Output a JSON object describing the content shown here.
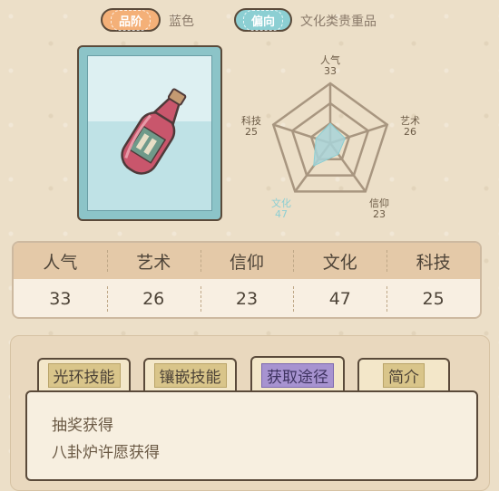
{
  "header": {
    "rank_label": "品阶",
    "rank_value": "蓝色",
    "bias_label": "偏向",
    "bias_value": "文化类贵重品"
  },
  "item": {
    "icon": "pink-bottle-icon"
  },
  "radar": {
    "labels": {
      "popularity": "人气",
      "art": "艺术",
      "faith": "信仰",
      "culture": "文化",
      "tech": "科技"
    },
    "values": {
      "popularity": "33",
      "art": "26",
      "faith": "23",
      "culture": "47",
      "tech": "25"
    },
    "max_value": 100,
    "highlight": "culture",
    "highlight_color": "#8ccfd3"
  },
  "stats_table": {
    "headers": [
      "人气",
      "艺术",
      "信仰",
      "文化",
      "科技"
    ],
    "values": [
      "33",
      "26",
      "23",
      "47",
      "25"
    ]
  },
  "tabs": [
    {
      "label": "光环技能",
      "active": false
    },
    {
      "label": "镶嵌技能",
      "active": false
    },
    {
      "label": "获取途径",
      "active": true
    },
    {
      "label": "简介",
      "active": false
    }
  ],
  "acquisition": {
    "lines": [
      "抽奖获得",
      "八卦炉许愿获得"
    ]
  }
}
